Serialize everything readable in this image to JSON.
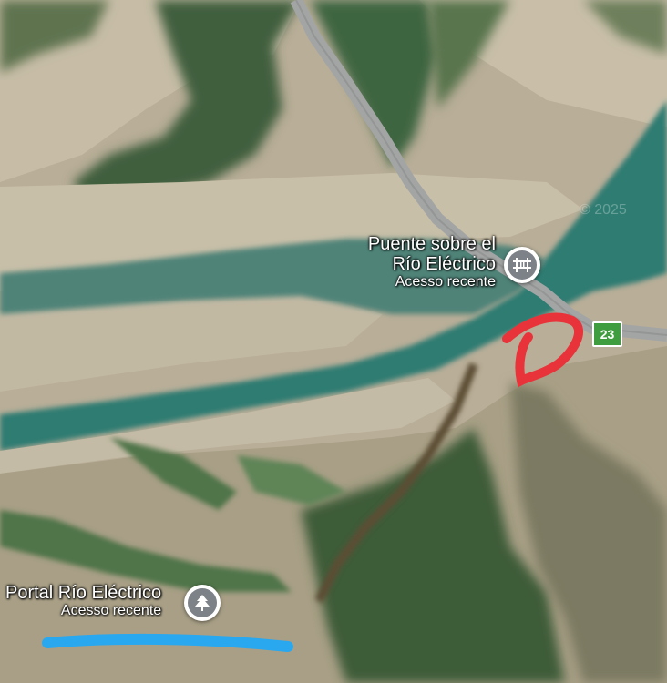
{
  "map": {
    "pois": [
      {
        "name_line1": "Puente sobre el",
        "name_line2": "Río Eléctrico",
        "subtitle": "Acesso recente",
        "icon": "bridge-icon"
      },
      {
        "name_line1": "Portal Río Eléctrico",
        "subtitle": "Acesso recente",
        "icon": "tree-icon"
      }
    ],
    "route_shield": {
      "number": "23",
      "color": "#3f9d3f"
    },
    "watermark": "© 2025",
    "colors": {
      "river": "#2f7c72",
      "road": "#9a9c9c",
      "annotation_circle": "#e8333a",
      "annotation_line": "#29a8f0"
    }
  }
}
